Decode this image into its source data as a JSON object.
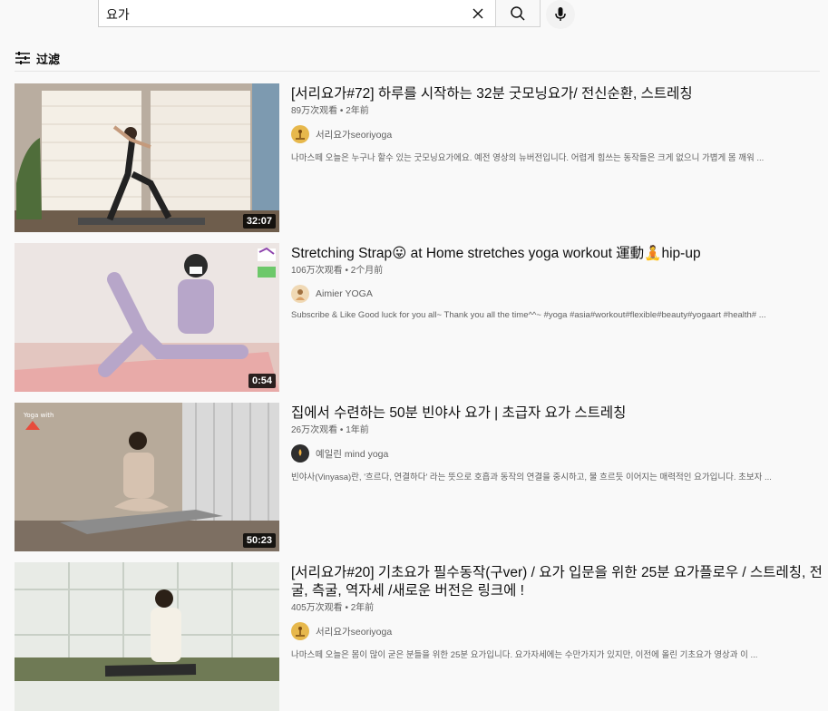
{
  "search": {
    "query": "요가"
  },
  "filter": {
    "label": "过滤"
  },
  "results": [
    {
      "title": "[서리요가#72] 하루를 시작하는 32분 굿모닝요가/ 전신순환, 스트레칭",
      "views": "89万次观看",
      "age": "2年前",
      "channel": "서리요가seoriyoga",
      "description": "나마스떼 오늘은 누구나 할수 있는 굿모닝요가에요. 예전 영상의 뉴버전입니다. 어렵게 힘쓰는 동작들은 크게 없으니 가볍게 몸 깨워 ...",
      "duration": "32:07"
    },
    {
      "title": "Stretching Strap😛 at Home stretches yoga workout 運動🧘hip-up",
      "views": "106万次观看",
      "age": "2个月前",
      "channel": "Aimier YOGA",
      "description": "Subscribe & Like Good luck for you all~ Thank you all the time^^~ #yoga #asia#workout#flexible#beauty#yogaart #health# ...",
      "duration": "0:54"
    },
    {
      "title": "집에서 수련하는 50분 빈야사 요가 | 초급자 요가 스트레칭",
      "views": "26万次观看",
      "age": "1年前",
      "channel": "예일린 mind yoga",
      "description": "빈야사(Vinyasa)란, '흐르다, 연결하다' 라는 뜻으로 호흡과 동작의 연결을 중시하고, 물 흐르듯 이어지는 매력적인 요가입니다. 초보자 ...",
      "duration": "50:23"
    },
    {
      "title": "[서리요가#20] 기초요가 필수동작(구ver) / 요가 입문을 위한 25분 요가플로우 / 스트레칭, 전굴, 측굴, 역자세 /새로운 버전은 링크에 !",
      "views": "405万次观看",
      "age": "2年前",
      "channel": "서리요가seoriyoga",
      "description": "나마스떼 오늘은 몸이 많이 굳은 분들을 위한 25분 요가입니다. 요가자세에는 수만가지가 있지만, 이전에 올린 기초요가 영상과 이 ..."
    }
  ],
  "colors": {
    "text_primary": "#0f0f0f",
    "text_secondary": "#606060",
    "background": "#f9f9f9"
  }
}
